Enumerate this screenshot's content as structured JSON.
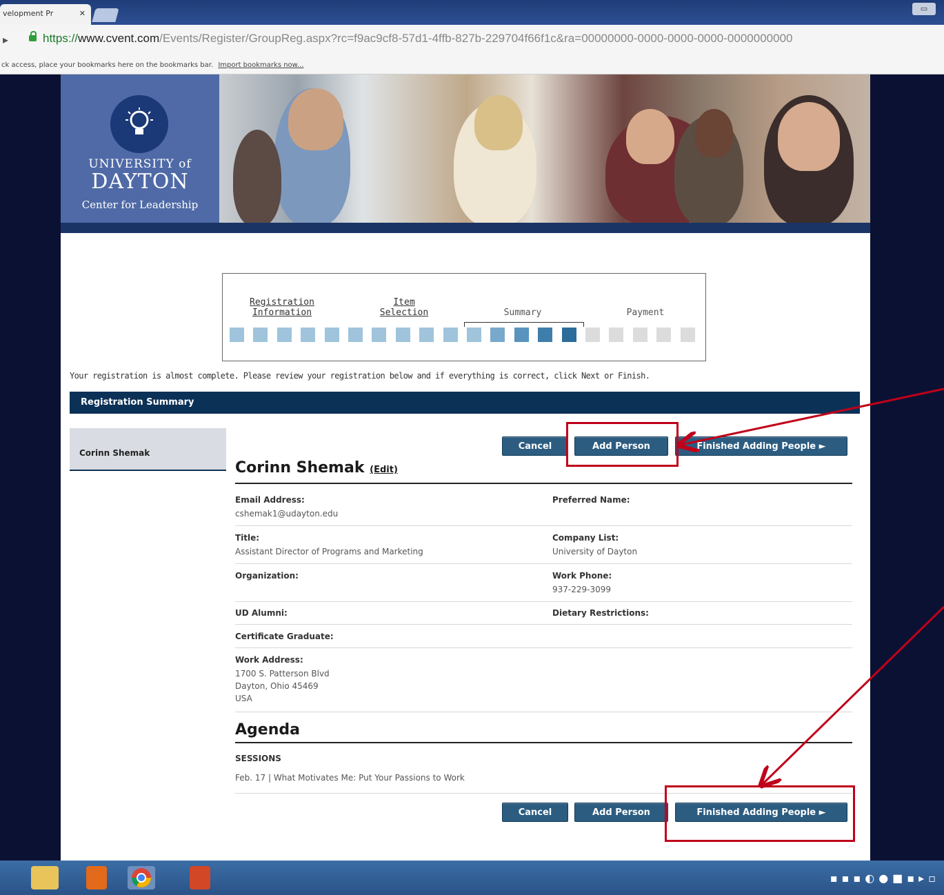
{
  "browser": {
    "tab_title": "velopment Pr",
    "tab_close": "✕",
    "window_button": "▭",
    "url_scheme": "https://",
    "url_domain": "www.cvent.com",
    "url_path": "/Events/Register/GroupReg.aspx?rc=f9ac9cf8-57d1-4ffb-827b-229704f66f1c&ra=00000000-0000-0000-0000-0000000000",
    "bookmarks_text": "ck access, place your bookmarks here on the bookmarks bar.",
    "bookmarks_link": "Import bookmarks now..."
  },
  "header": {
    "logo_line1": "UNIVERSITY of",
    "logo_line2": "DAYTON",
    "logo_line3": "Center for Leadership"
  },
  "progress": {
    "steps": [
      {
        "line1": "Registration",
        "line2": "Information",
        "link": true
      },
      {
        "line1": "Item",
        "line2": "Selection",
        "link": true
      },
      {
        "line1": "Summary",
        "line2": "",
        "link": false
      },
      {
        "line1": "Payment",
        "line2": "",
        "link": false
      }
    ],
    "completed_squares": 15,
    "total_squares": 20,
    "colors": {
      "done": "#9fc4dc",
      "current": [
        "#9fc4dc",
        "#78a9cc",
        "#5a93bd",
        "#3f7eab",
        "#2a6d9b"
      ],
      "pending": "#dcdcdc"
    }
  },
  "intro_text": "Your registration is almost complete. Please review your registration below and if everything is correct, click Next or Finish.",
  "summary": {
    "header": "Registration Summary",
    "side_person": "Corinn  Shemak",
    "buttons": {
      "cancel": "Cancel",
      "add_person": "Add Person",
      "finished": "Finished Adding People ►"
    },
    "person_name": "Corinn Shemak",
    "edit_link": "(Edit)",
    "fields": {
      "email_label": "Email Address:",
      "email_value": "cshemak1@udayton.edu",
      "preferred_label": "Preferred Name:",
      "title_label": "Title:",
      "title_value": "Assistant Director of Programs and Marketing",
      "company_label": "Company List:",
      "company_value": "University of Dayton",
      "org_label": "Organization:",
      "phone_label": "Work Phone:",
      "phone_value": "937-229-3099",
      "alumni_label": "UD Alumni:",
      "dietary_label": "Dietary Restrictions:",
      "cert_label": "Certificate Graduate:",
      "address_label": "Work Address:",
      "address_line1": "1700 S. Patterson Blvd",
      "address_line2": "Dayton, Ohio 45469",
      "address_line3": "USA"
    },
    "agenda_title": "Agenda",
    "sessions_label": "SESSIONS",
    "session_item": "Feb. 17 | What Motivates Me: Put Your Passions to Work"
  },
  "annotation_color": "#c0001a"
}
